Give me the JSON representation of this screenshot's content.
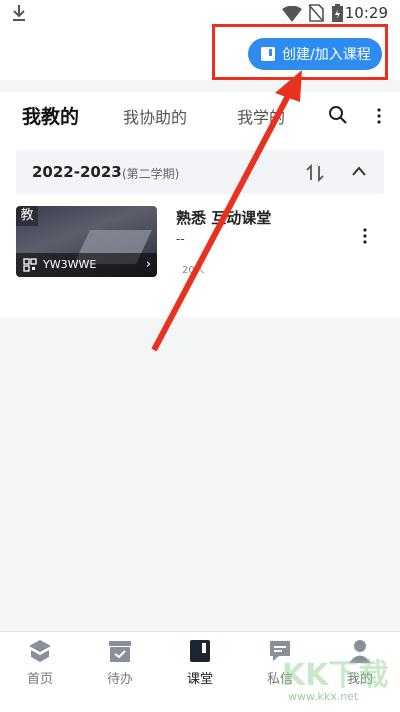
{
  "status_bar": {
    "time": "10:29"
  },
  "toolbar": {
    "create_join_label": "创建/加入课程"
  },
  "tabs": [
    {
      "label": "我教的",
      "active": true
    },
    {
      "label": "我协助的",
      "active": false
    },
    {
      "label": "我学的",
      "active": false
    }
  ],
  "group": {
    "year": "2022-2023",
    "term": "(第二学期)"
  },
  "course": {
    "badge": "教",
    "class_code": "YW3WWE",
    "title": "熟悉 互动课堂",
    "subtitle": "--",
    "member_count": "20人"
  },
  "bottom_nav": [
    {
      "label": "首页",
      "icon": "home-icon"
    },
    {
      "label": "待办",
      "icon": "todo-icon"
    },
    {
      "label": "课堂",
      "icon": "classroom-icon"
    },
    {
      "label": "私信",
      "icon": "message-icon"
    },
    {
      "label": "我的",
      "icon": "profile-icon"
    }
  ],
  "watermark": {
    "text": "KK下载",
    "url": "www.kkx.net"
  },
  "colors": {
    "accent": "#2e8cf0",
    "annotation": "#e8321f"
  }
}
